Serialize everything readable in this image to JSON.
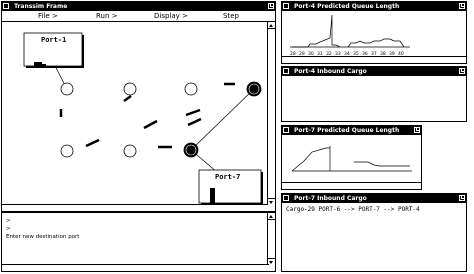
{
  "main_window": {
    "title": "Transsim Frame",
    "menu": [
      "File >",
      "Run >",
      "Display >",
      "Step"
    ],
    "ports": [
      {
        "label": "Port-1"
      },
      {
        "label": "Port-7"
      }
    ]
  },
  "console": {
    "lines": [
      ">",
      ">",
      "Enter new destination port"
    ]
  },
  "queue_windows": [
    {
      "title": "Port-4 Predicted Queue Length",
      "axis_labels": [
        "28",
        "29",
        "30",
        "31",
        "32",
        "33",
        "34",
        "35",
        "36",
        "37",
        "38",
        "39",
        "40"
      ]
    },
    {
      "title": "Port-7 Predicted Queue Length"
    }
  ],
  "cargo_windows": [
    {
      "title": "Port-4 Inbound Cargo",
      "text": ""
    },
    {
      "title": "Port-7 Inbound Cargo",
      "text": "Cargo-29   PORT-6 --> PORT-7 --> PORT-4"
    }
  ]
}
